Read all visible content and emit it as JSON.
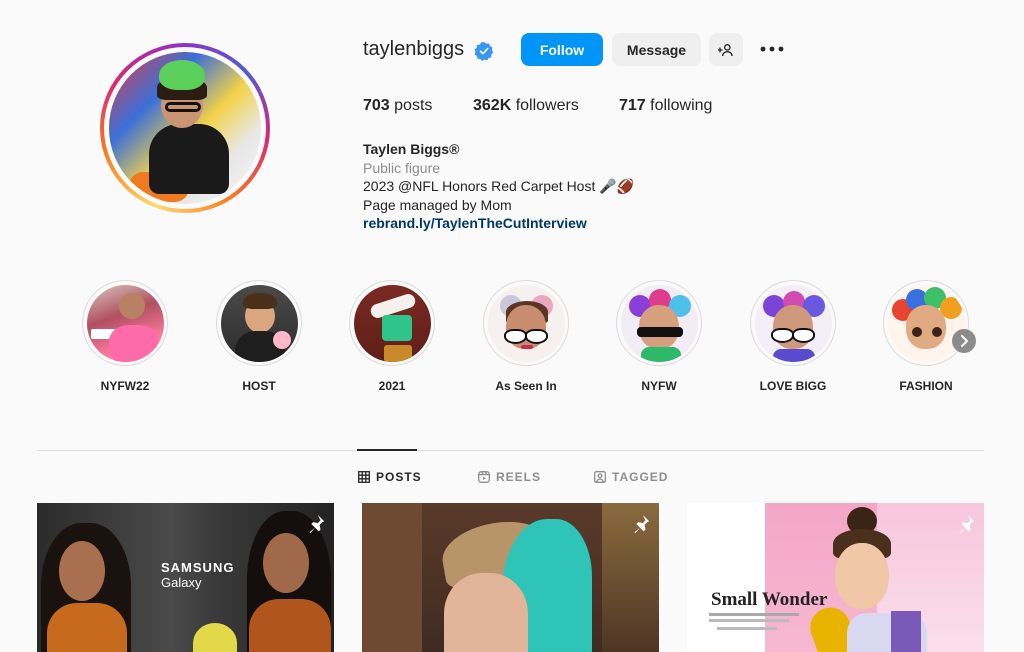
{
  "profile": {
    "username": "taylenbiggs",
    "follow_label": "Follow",
    "message_label": "Message",
    "stats": {
      "posts_count": "703",
      "posts_label": "posts",
      "followers_count": "362K",
      "followers_label": "followers",
      "following_count": "717",
      "following_label": "following"
    },
    "bio": {
      "name": "Taylen Biggs®",
      "category": "Public figure",
      "line1": "2023 @NFL Honors Red Carpet Host 🎤🏈",
      "line2": "Page managed by Mom",
      "link": "rebrand.ly/TaylenTheCutInterview"
    }
  },
  "highlights": [
    {
      "label": "NYFW22"
    },
    {
      "label": "HOST"
    },
    {
      "label": "2021"
    },
    {
      "label": "As Seen In"
    },
    {
      "label": "NYFW"
    },
    {
      "label": "LOVE BIGG"
    },
    {
      "label": "FASHION"
    }
  ],
  "tabs": [
    {
      "label": "POSTS",
      "active": true
    },
    {
      "label": "REELS",
      "active": false
    },
    {
      "label": "TAGGED",
      "active": false
    }
  ],
  "posts": {
    "post1": {
      "text_1": "SAMSUNG",
      "text_2": "Galaxy"
    },
    "post3": {
      "headline": "Small Wonder"
    }
  },
  "colors": {
    "accent": "#0095f6",
    "verified": "#3897f0",
    "link": "#00376b",
    "muted": "#8e8e8e",
    "background": "#fafafa"
  },
  "icons": [
    "verified-badge-icon",
    "add-user-icon",
    "more-icon",
    "grid-icon",
    "reels-icon",
    "tagged-icon",
    "pin-icon",
    "chevron-right-icon"
  ]
}
